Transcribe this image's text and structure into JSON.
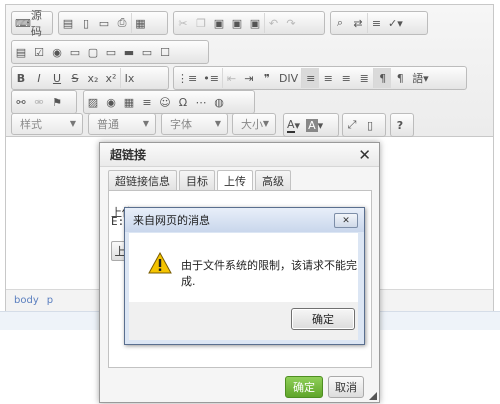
{
  "toolbar": {
    "source_label": "源码",
    "row2_icons": [
      "form-icon",
      "checkbox-icon",
      "radio-icon",
      "textfield-icon",
      "textarea-icon",
      "select-icon",
      "button-icon",
      "imagebutton-icon",
      "hiddenfield-icon"
    ],
    "styles_combo": "样式",
    "format_combo": "普通",
    "font_combo": "字体",
    "size_combo": "大小"
  },
  "statusbar": {
    "path": [
      "body",
      "p"
    ]
  },
  "link_dialog": {
    "title": "超链接",
    "tabs": [
      "超链接信息",
      "目标",
      "上传",
      "高级"
    ],
    "active_tab_index": 2,
    "upload_label": "上传",
    "upload_path": "E:\\",
    "upload_button": "上",
    "ok_label": "确定",
    "cancel_label": "取消"
  },
  "message_box": {
    "title": "来自网页的消息",
    "text": "由于文件系统的限制，该请求不能完成.",
    "ok_label": "确定",
    "close_label": "✕"
  },
  "colors": {
    "ok_green": "#6cb33e",
    "msg_frame": "#dce6f4",
    "warning_yellow": "#f5c400"
  }
}
